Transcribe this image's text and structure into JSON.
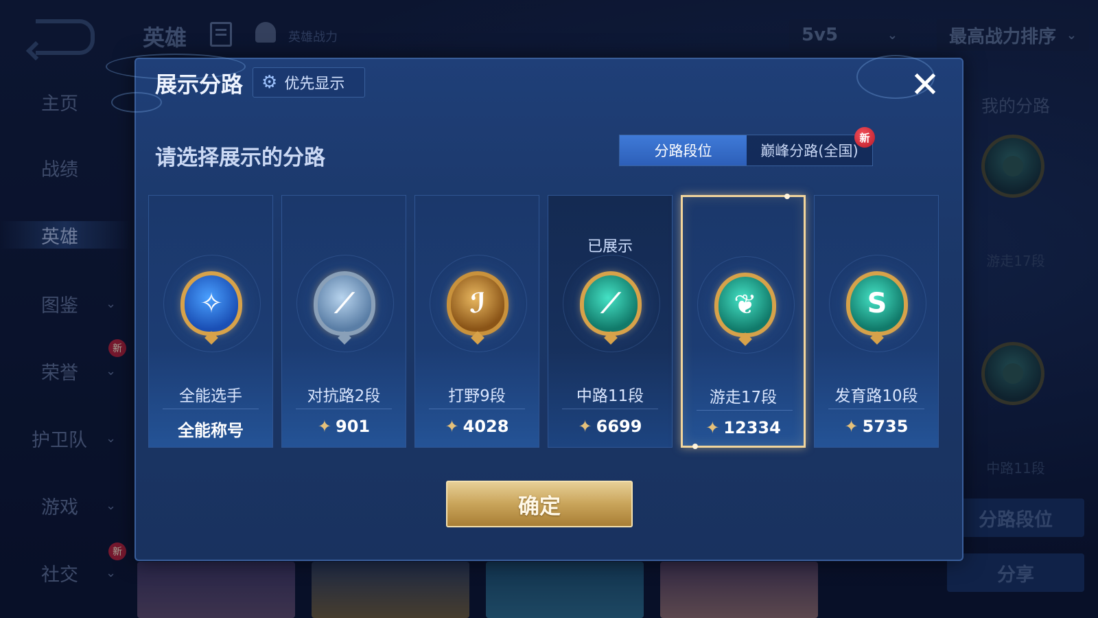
{
  "background": {
    "title": "英雄",
    "power_label": "英雄战力",
    "mode_select": "5v5",
    "sort_select": "最高战力排序",
    "sidebar": [
      {
        "label": "主页",
        "chevron": false,
        "new": false
      },
      {
        "label": "战绩",
        "chevron": false,
        "new": false
      },
      {
        "label": "英雄",
        "chevron": false,
        "new": false,
        "active": true
      },
      {
        "label": "图鉴",
        "chevron": true,
        "new": false
      },
      {
        "label": "荣誉",
        "chevron": true,
        "new": true
      },
      {
        "label": "护卫队",
        "chevron": true,
        "new": false
      },
      {
        "label": "游戏",
        "chevron": true,
        "new": false
      },
      {
        "label": "社交",
        "chevron": true,
        "new": true
      }
    ],
    "new_badge": "新",
    "right_panel": {
      "title": "我的分路",
      "lane1": "游走17段",
      "lane2": "中路11段",
      "lane_rank_button": "分路段位",
      "share_button": "分享"
    }
  },
  "modal": {
    "title": "展示分路",
    "priority_button": "优先显示",
    "close_icon": "✕",
    "prompt": "请选择展示的分路",
    "tabs": [
      {
        "label": "分路段位",
        "active": true
      },
      {
        "label": "巅峰分路(全国)",
        "active": false,
        "badge": "新"
      }
    ],
    "cards": [
      {
        "lane": "全能选手",
        "score": "全能称号",
        "has_points_icon": false,
        "emblem": "allround",
        "shown": false,
        "selected": false
      },
      {
        "lane": "对抗路2段",
        "score": "901",
        "has_points_icon": true,
        "emblem": "clash",
        "shown": false,
        "selected": false
      },
      {
        "lane": "打野9段",
        "score": "4028",
        "has_points_icon": true,
        "emblem": "jungle",
        "shown": false,
        "selected": false
      },
      {
        "lane": "中路11段",
        "score": "6699",
        "has_points_icon": true,
        "emblem": "mid",
        "shown": true,
        "selected": false
      },
      {
        "lane": "游走17段",
        "score": "12334",
        "has_points_icon": true,
        "emblem": "roam",
        "shown": false,
        "selected": true
      },
      {
        "lane": "发育路10段",
        "score": "5735",
        "has_points_icon": true,
        "emblem": "adc",
        "shown": false,
        "selected": false
      }
    ],
    "shown_tag": "已展示",
    "confirm_button": "确定"
  },
  "colors": {
    "accent_blue": "#3f7ad8",
    "gold": "#c9a45a",
    "selected_border": "#f2d59c",
    "badge_red": "#b81a28"
  }
}
